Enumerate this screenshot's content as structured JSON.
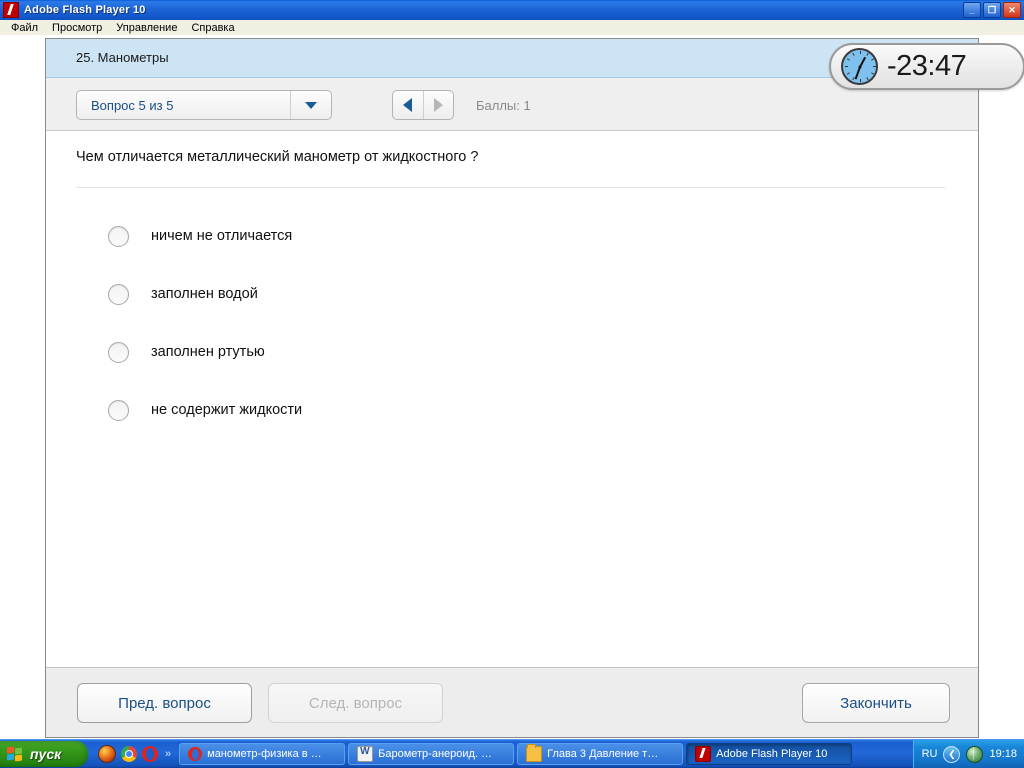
{
  "window": {
    "title": "Adobe Flash Player 10",
    "icon": "flash-icon",
    "menus": [
      "Файл",
      "Просмотр",
      "Управление",
      "Справка"
    ],
    "controls": {
      "minimize": "_",
      "restore": "❐",
      "close": "✕"
    }
  },
  "quiz": {
    "header_title": "25. Манометры",
    "question_selector": "Вопрос 5 из 5",
    "score_label": "Баллы: 1",
    "timer": "-23:47",
    "question_text": "Чем отличается металлический манометр от жидкостного ?",
    "options": [
      {
        "label": "ничем не отличается",
        "selected": false
      },
      {
        "label": "заполнен водой",
        "selected": false
      },
      {
        "label": "заполнен ртутью",
        "selected": false
      },
      {
        "label": "не содержит жидкости",
        "selected": false
      }
    ],
    "buttons": {
      "prev": "Пред. вопрос",
      "next": "След. вопрос",
      "finish": "Закончить"
    }
  },
  "taskbar": {
    "start": "пуск",
    "quicklaunch_overflow": "»",
    "tasks": [
      {
        "label": "манометр-физика в …",
        "icon": "opera-icon",
        "active": false
      },
      {
        "label": "Барометр-анероид. …",
        "icon": "word-doc-icon",
        "active": false
      },
      {
        "label": "Глава 3 Давление т…",
        "icon": "folder-icon",
        "active": false
      },
      {
        "label": "Adobe Flash Player 10",
        "icon": "flash-icon",
        "active": true
      }
    ],
    "tray": {
      "language": "RU",
      "expand": "❮",
      "clock": "19:18"
    }
  },
  "colors": {
    "titlebar_blue": "#1e66d8",
    "quiz_header_blue": "#cde4f5",
    "link_blue": "#1b4f87",
    "disabled_gray": "#b5b5b5",
    "taskbar_blue": "#1a5fd0",
    "start_green": "#2b8a14"
  }
}
